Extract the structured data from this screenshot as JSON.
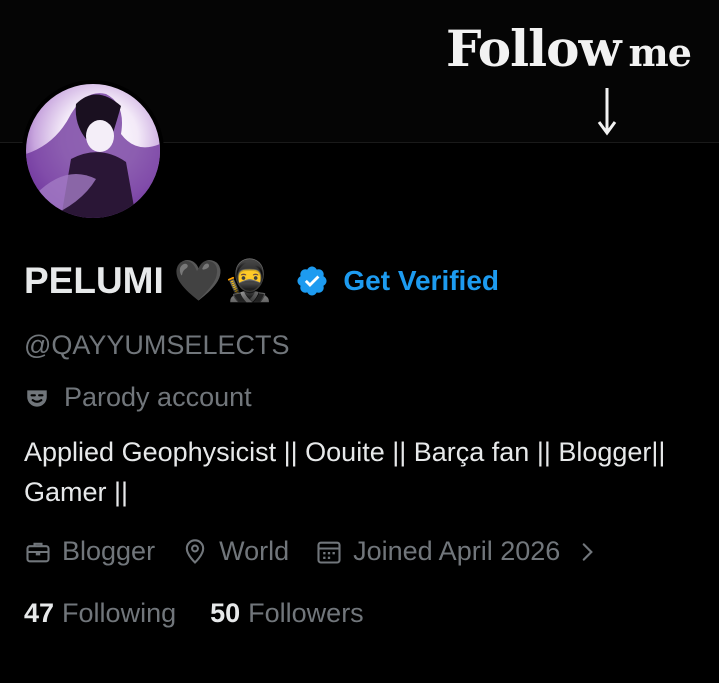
{
  "banner": {
    "text_big": "Follow",
    "text_small": "me"
  },
  "profile": {
    "name": "PELUMI",
    "name_emoji": "🖤🥷",
    "get_verified": "Get Verified",
    "handle": "@QAYYUMSELECTS",
    "parody_label": "Parody account",
    "bio": "Applied Geophysicist || Oouite || Barça fan || Blogger|| Gamer ||",
    "category": "Blogger",
    "location": "World",
    "joined": "Joined April 2026"
  },
  "stats": {
    "following_count": "47",
    "following_label": "Following",
    "followers_count": "50",
    "followers_label": "Followers"
  },
  "colors": {
    "accent": "#1d9bf0",
    "muted": "#71767b",
    "text": "#e7e9ea",
    "background": "#000000"
  }
}
